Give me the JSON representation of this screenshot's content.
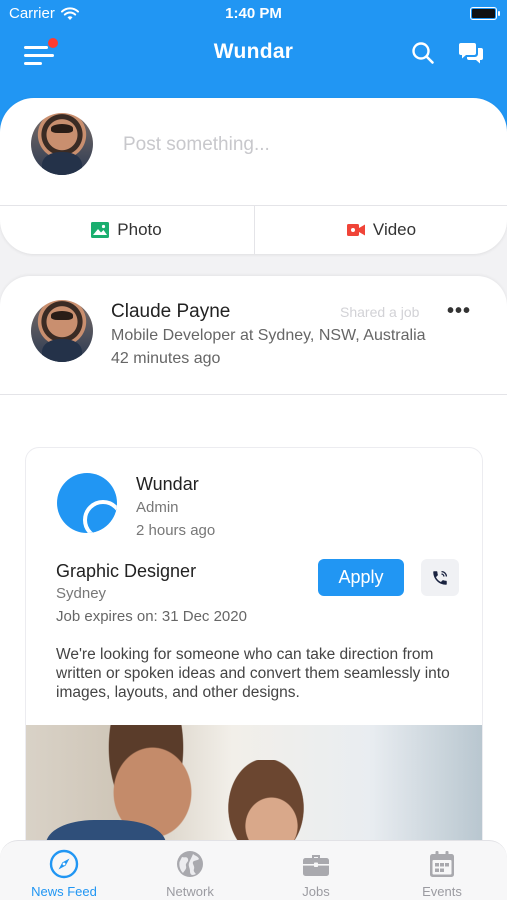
{
  "status_bar": {
    "carrier": "Carrier",
    "time": "1:40 PM"
  },
  "header": {
    "title": "Wundar",
    "has_notification": true
  },
  "composer": {
    "placeholder": "Post something...",
    "photo_label": "Photo",
    "video_label": "Video"
  },
  "post": {
    "author": "Claude Payne",
    "shared_tag": "Shared a job",
    "author_role": "Mobile Developer at Sydney, NSW, Australia",
    "time_ago": "42 minutes ago",
    "more_label": "•••"
  },
  "job": {
    "company": "Wundar",
    "poster_role": "Admin",
    "posted_ago": "2 hours ago",
    "title": "Graphic Designer",
    "location": "Sydney",
    "expires": "Job expires on: 31 Dec 2020",
    "apply_label": "Apply",
    "description": "We're looking for someone who can take direction from written or spoken ideas and convert them seamlessly into images, layouts, and other designs."
  },
  "tabs": [
    {
      "label": "News Feed",
      "icon": "compass-icon",
      "active": true
    },
    {
      "label": "Network",
      "icon": "globe-icon",
      "active": false
    },
    {
      "label": "Jobs",
      "icon": "briefcase-icon",
      "active": false
    },
    {
      "label": "Events",
      "icon": "calendar-icon",
      "active": false
    }
  ],
  "colors": {
    "primary": "#2196f3",
    "notification": "#ff3b30",
    "photo_icon": "#1aae6f",
    "video_icon": "#f04438"
  }
}
